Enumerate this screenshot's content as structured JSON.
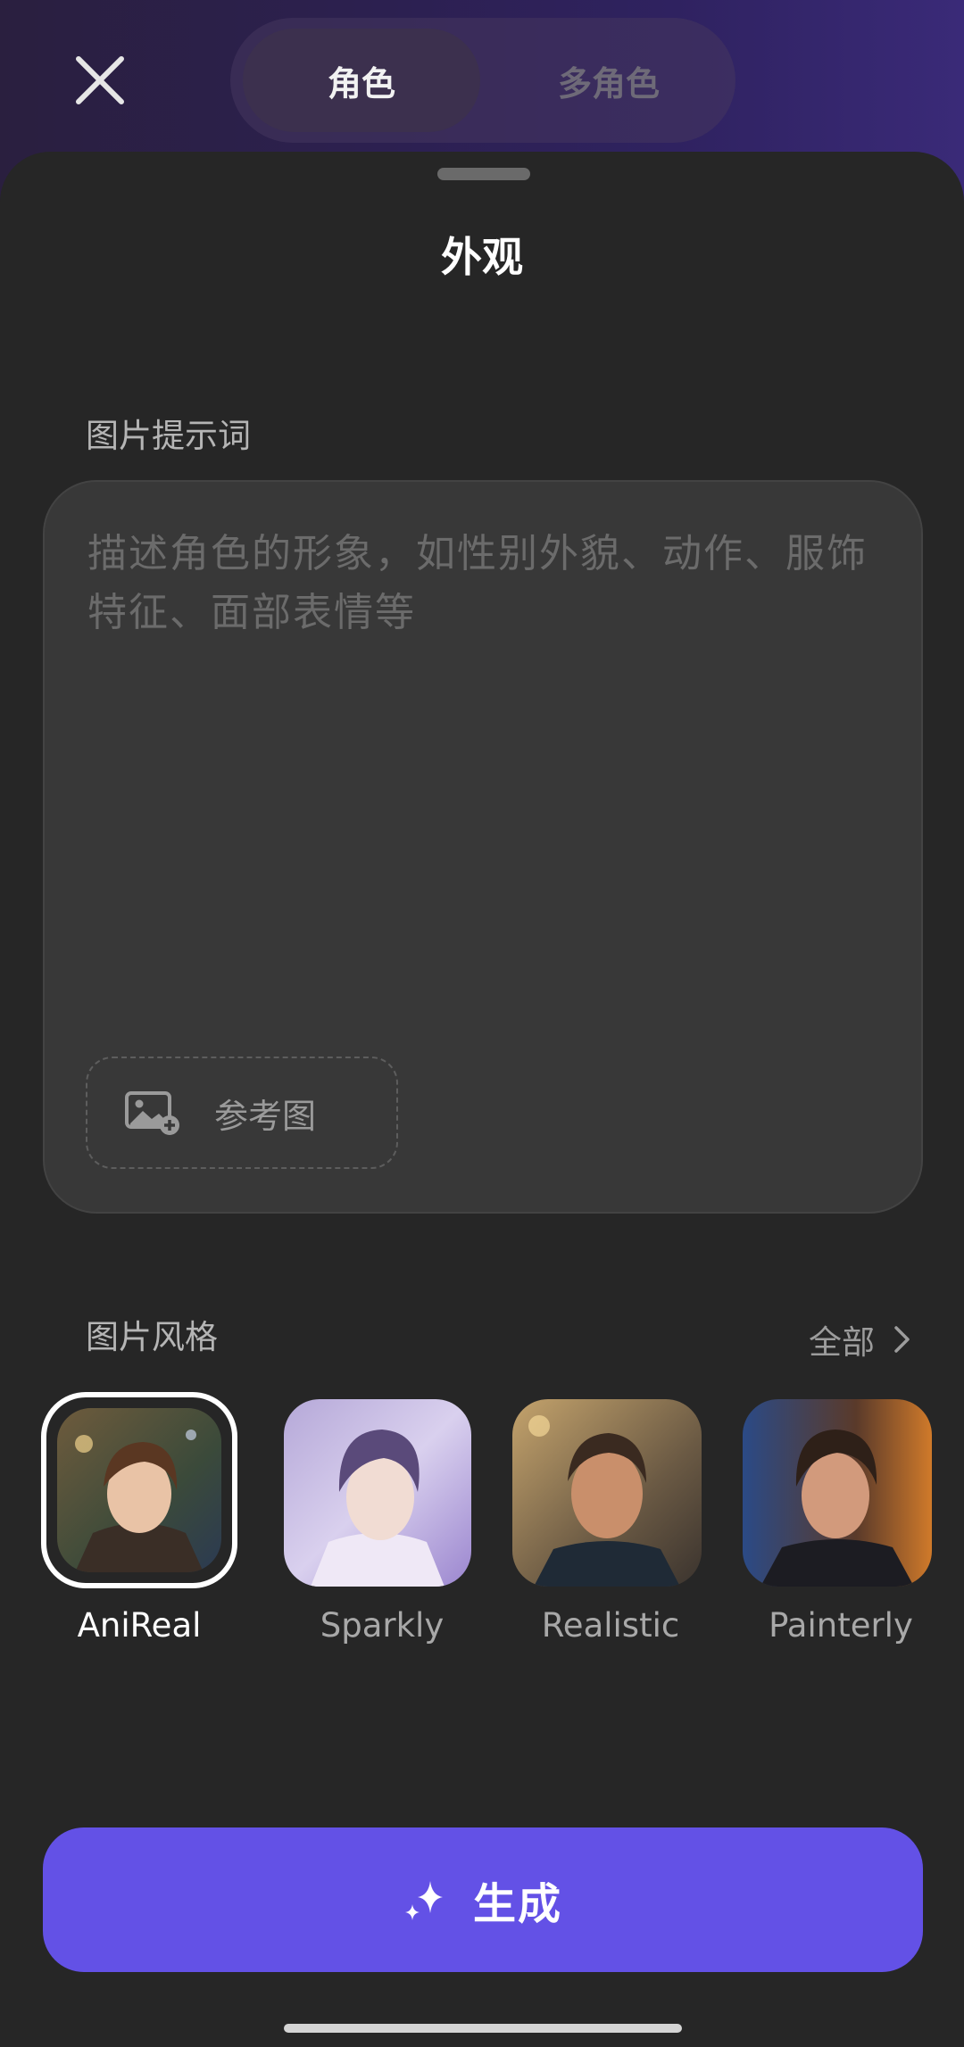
{
  "header": {
    "tabs": [
      {
        "label": "角色",
        "active": true
      },
      {
        "label": "多角色",
        "active": false
      }
    ]
  },
  "sheet": {
    "title": "外观",
    "prompt_label": "图片提示词",
    "prompt_placeholder": "描述角色的形象，如性别外貌、动作、服饰特征、面部表情等",
    "reference_button": "参考图",
    "style_label": "图片风格",
    "all_link": "全部",
    "styles": [
      {
        "name": "AniReal",
        "selected": true
      },
      {
        "name": "Sparkly",
        "selected": false
      },
      {
        "name": "Realistic",
        "selected": false
      },
      {
        "name": "Painterly",
        "selected": false
      }
    ],
    "generate_button": "生成"
  },
  "colors": {
    "accent": "#6351e6",
    "sheet_bg": "#262626",
    "input_bg": "#383838"
  },
  "icons": [
    "close-icon",
    "image-add-icon",
    "chevron-right-icon",
    "sparkle-icon"
  ]
}
